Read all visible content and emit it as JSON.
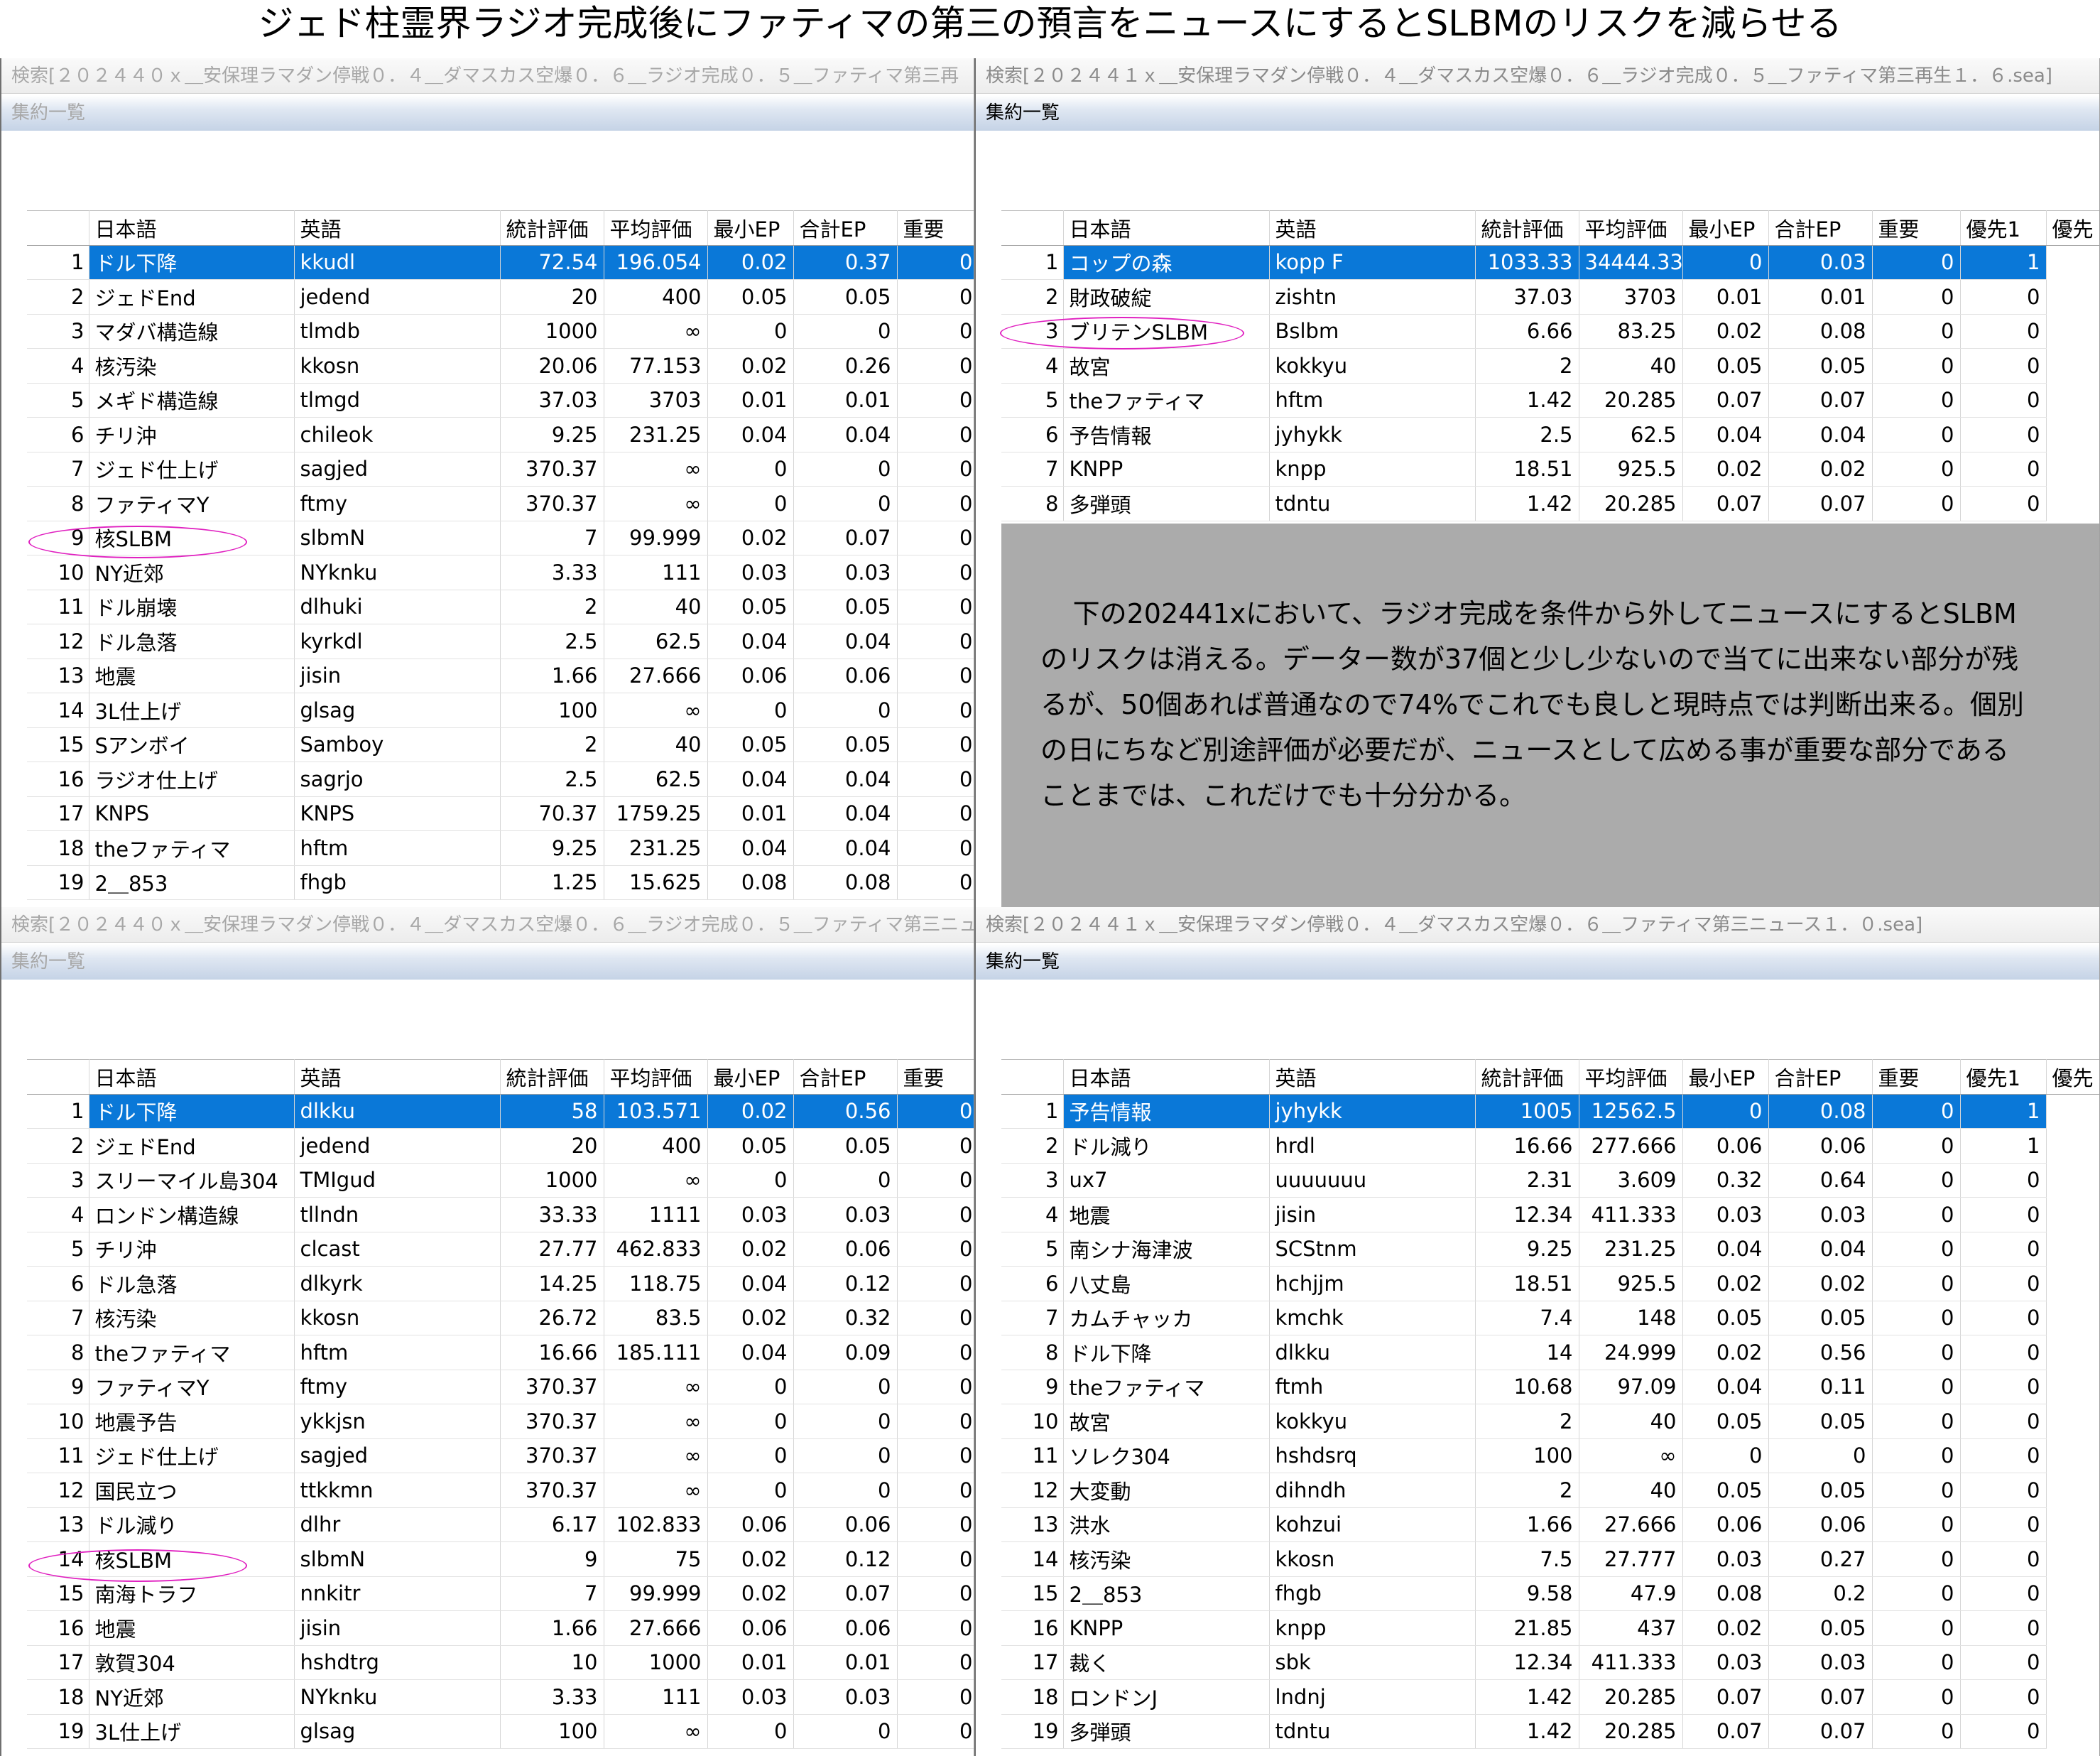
{
  "page_title": "ジェド柱霊界ラジオ完成後にファティマの第三の預言をニュースにするとSLBMのリスクを減らせる",
  "columns_short": [
    "日本語",
    "英語",
    "統計評価",
    "平均評価",
    "最小EP",
    "合計EP",
    "重要"
  ],
  "columns_long": [
    "日本語",
    "英語",
    "統計評価",
    "平均評価",
    "最小EP",
    "合計EP",
    "重要",
    "優先1",
    "優先"
  ],
  "panels": {
    "top_left": {
      "title": "検索[２０２４４０ｘ＿安保理ラマダン停戦０．４＿ダマスカス空爆０．６＿ラジオ完成０．５＿ファティマ第三再",
      "subtitle": "集約一覧",
      "rows": [
        [
          "1",
          "ドル下降",
          "kkudl",
          "72.54",
          "196.054",
          "0.02",
          "0.37",
          "0"
        ],
        [
          "2",
          "ジェドEnd",
          "jedend",
          "20",
          "400",
          "0.05",
          "0.05",
          "0"
        ],
        [
          "3",
          "マダバ構造線",
          "tlmdb",
          "1000",
          "∞",
          "0",
          "0",
          "0"
        ],
        [
          "4",
          "核汚染",
          "kkosn",
          "20.06",
          "77.153",
          "0.02",
          "0.26",
          "0"
        ],
        [
          "5",
          "メギド構造線",
          "tlmgd",
          "37.03",
          "3703",
          "0.01",
          "0.01",
          "0"
        ],
        [
          "6",
          "チリ沖",
          "chileok",
          "9.25",
          "231.25",
          "0.04",
          "0.04",
          "0"
        ],
        [
          "7",
          "ジェド仕上げ",
          "sagjed",
          "370.37",
          "∞",
          "0",
          "0",
          "0"
        ],
        [
          "8",
          "ファティマY",
          "ftmy",
          "370.37",
          "∞",
          "0",
          "0",
          "0"
        ],
        [
          "9",
          "核SLBM",
          "slbmN",
          "7",
          "99.999",
          "0.02",
          "0.07",
          "0"
        ],
        [
          "10",
          "NY近郊",
          "NYknku",
          "3.33",
          "111",
          "0.03",
          "0.03",
          "0"
        ],
        [
          "11",
          "ドル崩壊",
          "dlhuki",
          "2",
          "40",
          "0.05",
          "0.05",
          "0"
        ],
        [
          "12",
          "ドル急落",
          "kyrkdl",
          "2.5",
          "62.5",
          "0.04",
          "0.04",
          "0"
        ],
        [
          "13",
          "地震",
          "jisin",
          "1.66",
          "27.666",
          "0.06",
          "0.06",
          "0"
        ],
        [
          "14",
          "3L仕上げ",
          "glsag",
          "100",
          "∞",
          "0",
          "0",
          "0"
        ],
        [
          "15",
          "Sアンボイ",
          "Samboy",
          "2",
          "40",
          "0.05",
          "0.05",
          "0"
        ],
        [
          "16",
          "ラジオ仕上げ",
          "sagrjo",
          "2.5",
          "62.5",
          "0.04",
          "0.04",
          "0"
        ],
        [
          "17",
          "KNPS",
          "KNPS",
          "70.37",
          "1759.25",
          "0.01",
          "0.04",
          "0"
        ],
        [
          "18",
          "theファティマ",
          "hftm",
          "9.25",
          "231.25",
          "0.04",
          "0.04",
          "0"
        ],
        [
          "19",
          "2＿853",
          "fhgb",
          "1.25",
          "15.625",
          "0.08",
          "0.08",
          "0"
        ]
      ]
    },
    "top_right": {
      "title": "検索[２０２４４１ｘ＿安保理ラマダン停戦０．４＿ダマスカス空爆０．６＿ラジオ完成０．５＿ファティマ第三再生１．６.sea]",
      "subtitle": "集約一覧",
      "rows": [
        [
          "1",
          "コップの森",
          "kopp F",
          "1033.33",
          "34444.333",
          "0",
          "0.03",
          "0",
          "1"
        ],
        [
          "2",
          "財政破綻",
          "zishtn",
          "37.03",
          "3703",
          "0.01",
          "0.01",
          "0",
          "0"
        ],
        [
          "3",
          "ブリテンSLBM",
          "Bslbm",
          "6.66",
          "83.25",
          "0.02",
          "0.08",
          "0",
          "0"
        ],
        [
          "4",
          "故宮",
          "kokkyu",
          "2",
          "40",
          "0.05",
          "0.05",
          "0",
          "0"
        ],
        [
          "5",
          "theファティマ",
          "hftm",
          "1.42",
          "20.285",
          "0.07",
          "0.07",
          "0",
          "0"
        ],
        [
          "6",
          "予告情報",
          "jyhykk",
          "2.5",
          "62.5",
          "0.04",
          "0.04",
          "0",
          "0"
        ],
        [
          "7",
          "KNPP",
          "knpp",
          "18.51",
          "925.5",
          "0.02",
          "0.02",
          "0",
          "0"
        ],
        [
          "8",
          "多弾頭",
          "tdntu",
          "1.42",
          "20.285",
          "0.07",
          "0.07",
          "0",
          "0"
        ]
      ],
      "note": "下の202441xにおいて、ラジオ完成を条件から外してニュースにするとSLBMのリスクは消える。データー数が37個と少し少ないので当てに出来ない部分が残るが、50個あれば普通なので74%でこれでも良しと現時点では判断出来る。個別の日にちなど別途評価が必要だが、ニュースとして広める事が重要な部分であることまでは、これだけでも十分分かる。"
    },
    "bottom_left": {
      "title": "検索[２０２４４０ｘ＿安保理ラマダン停戦０．４＿ダマスカス空爆０．６＿ラジオ完成０．５＿ファティマ第三ニュ",
      "subtitle": "集約一覧",
      "rows": [
        [
          "1",
          "ドル下降",
          "dlkku",
          "58",
          "103.571",
          "0.02",
          "0.56",
          "0"
        ],
        [
          "2",
          "ジェドEnd",
          "jedend",
          "20",
          "400",
          "0.05",
          "0.05",
          "0"
        ],
        [
          "3",
          "スリーマイル島304",
          "TMIgud",
          "1000",
          "∞",
          "0",
          "0",
          "0"
        ],
        [
          "4",
          "ロンドン構造線",
          "tllndn",
          "33.33",
          "1111",
          "0.03",
          "0.03",
          "0"
        ],
        [
          "5",
          "チリ沖",
          "clcast",
          "27.77",
          "462.833",
          "0.02",
          "0.06",
          "0"
        ],
        [
          "6",
          "ドル急落",
          "dlkyrk",
          "14.25",
          "118.75",
          "0.04",
          "0.12",
          "0"
        ],
        [
          "7",
          "核汚染",
          "kkosn",
          "26.72",
          "83.5",
          "0.02",
          "0.32",
          "0"
        ],
        [
          "8",
          "theファティマ",
          "hftm",
          "16.66",
          "185.111",
          "0.04",
          "0.09",
          "0"
        ],
        [
          "9",
          "ファティマY",
          "ftmy",
          "370.37",
          "∞",
          "0",
          "0",
          "0"
        ],
        [
          "10",
          "地震予告",
          "ykkjsn",
          "370.37",
          "∞",
          "0",
          "0",
          "0"
        ],
        [
          "11",
          "ジェド仕上げ",
          "sagjed",
          "370.37",
          "∞",
          "0",
          "0",
          "0"
        ],
        [
          "12",
          "国民立つ",
          "ttkkmn",
          "370.37",
          "∞",
          "0",
          "0",
          "0"
        ],
        [
          "13",
          "ドル減り",
          "dlhr",
          "6.17",
          "102.833",
          "0.06",
          "0.06",
          "0"
        ],
        [
          "14",
          "核SLBM",
          "slbmN",
          "9",
          "75",
          "0.02",
          "0.12",
          "0"
        ],
        [
          "15",
          "南海トラフ",
          "nnkitr",
          "7",
          "99.999",
          "0.02",
          "0.07",
          "0"
        ],
        [
          "16",
          "地震",
          "jisin",
          "1.66",
          "27.666",
          "0.06",
          "0.06",
          "0"
        ],
        [
          "17",
          "敦賀304",
          "hshdtrg",
          "10",
          "1000",
          "0.01",
          "0.01",
          "0"
        ],
        [
          "18",
          "NY近郊",
          "NYknku",
          "3.33",
          "111",
          "0.03",
          "0.03",
          "0"
        ],
        [
          "19",
          "3L仕上げ",
          "glsag",
          "100",
          "∞",
          "0",
          "0",
          "0"
        ]
      ]
    },
    "bottom_right": {
      "title": "検索[２０２４４１ｘ＿安保理ラマダン停戦０．４＿ダマスカス空爆０．６＿ファティマ第三ニュース１．０.sea]",
      "subtitle": "集約一覧",
      "rows": [
        [
          "1",
          "予告情報",
          "jyhykk",
          "1005",
          "12562.5",
          "0",
          "0.08",
          "0",
          "1"
        ],
        [
          "2",
          "ドル減り",
          "hrdl",
          "16.66",
          "277.666",
          "0.06",
          "0.06",
          "0",
          "1"
        ],
        [
          "3",
          "ux7",
          "uuuuuuu",
          "2.31",
          "3.609",
          "0.32",
          "0.64",
          "0",
          "0"
        ],
        [
          "4",
          "地震",
          "jisin",
          "12.34",
          "411.333",
          "0.03",
          "0.03",
          "0",
          "0"
        ],
        [
          "5",
          "南シナ海津波",
          "SCStnm",
          "9.25",
          "231.25",
          "0.04",
          "0.04",
          "0",
          "0"
        ],
        [
          "6",
          "八丈島",
          "hchjjm",
          "18.51",
          "925.5",
          "0.02",
          "0.02",
          "0",
          "0"
        ],
        [
          "7",
          "カムチャッカ",
          "kmchk",
          "7.4",
          "148",
          "0.05",
          "0.05",
          "0",
          "0"
        ],
        [
          "8",
          "ドル下降",
          "dlkku",
          "14",
          "24.999",
          "0.02",
          "0.56",
          "0",
          "0"
        ],
        [
          "9",
          "theファティマ",
          "ftmh",
          "10.68",
          "97.09",
          "0.04",
          "0.11",
          "0",
          "0"
        ],
        [
          "10",
          "故宮",
          "kokkyu",
          "2",
          "40",
          "0.05",
          "0.05",
          "0",
          "0"
        ],
        [
          "11",
          "ソレク304",
          "hshdsrq",
          "100",
          "∞",
          "0",
          "0",
          "0",
          "0"
        ],
        [
          "12",
          "大変動",
          "dihndh",
          "2",
          "40",
          "0.05",
          "0.05",
          "0",
          "0"
        ],
        [
          "13",
          "洪水",
          "kohzui",
          "1.66",
          "27.666",
          "0.06",
          "0.06",
          "0",
          "0"
        ],
        [
          "14",
          "核汚染",
          "kkosn",
          "7.5",
          "27.777",
          "0.03",
          "0.27",
          "0",
          "0"
        ],
        [
          "15",
          "2＿853",
          "fhgb",
          "9.58",
          "47.9",
          "0.08",
          "0.2",
          "0",
          "0"
        ],
        [
          "16",
          "KNPP",
          "knpp",
          "21.85",
          "437",
          "0.02",
          "0.05",
          "0",
          "0"
        ],
        [
          "17",
          "裁く",
          "sbk",
          "12.34",
          "411.333",
          "0.03",
          "0.03",
          "0",
          "0"
        ],
        [
          "18",
          "ロンドンJ",
          "lndnj",
          "1.42",
          "20.285",
          "0.07",
          "0.07",
          "0",
          "0"
        ],
        [
          "19",
          "多弾頭",
          "tdntu",
          "1.42",
          "20.285",
          "0.07",
          "0.07",
          "0",
          "0"
        ]
      ]
    }
  },
  "colors": {
    "selection": "#0a78d8",
    "highlight_oval": "#e020c0",
    "note_background": "#ababab"
  }
}
